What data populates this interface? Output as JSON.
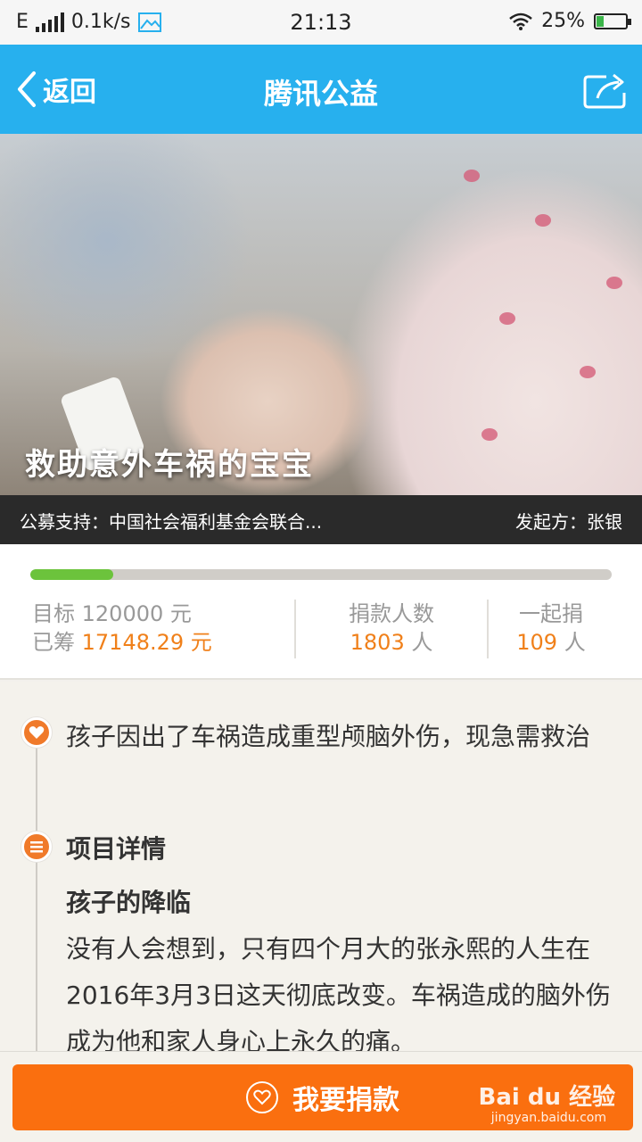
{
  "status_bar": {
    "network": "E",
    "speed": "0.1k/s",
    "time": "21:13",
    "battery": "25%",
    "battery_level": 0.25
  },
  "nav": {
    "back_label": "返回",
    "title": "腾讯公益"
  },
  "hero": {
    "title": "救助意外车祸的宝宝",
    "support": "公募支持：中国社会福利基金会联合...",
    "initiator": "发起方：张银"
  },
  "stats": {
    "progress_fraction": 0.143,
    "target_label": "目标",
    "target_value": "120000",
    "target_unit": "元",
    "raised_label": "已筹",
    "raised_value": "17148.29",
    "raised_unit": "元",
    "donors_label": "捐款人数",
    "donors_value": "1803",
    "donors_unit": "人",
    "together_label": "一起捐",
    "together_value": "109",
    "together_unit": "人"
  },
  "content": {
    "summary": "孩子因出了车祸造成重型颅脑外伤，现急需救治",
    "detail_heading": "项目详情",
    "sub_heading": "孩子的降临",
    "paragraph": "没有人会想到，只有四个月大的张永熙的人生在2016年3月3日这天彻底改变。车祸造成的脑外伤成为他和家人身心上永久的痛。"
  },
  "bottom": {
    "donate_label": "我要捐款",
    "watermark": "Bai du 经验",
    "watermark_url": "jingyan.baidu.com"
  },
  "colors": {
    "nav_bg": "#27b0ee",
    "accent_orange": "#fa6f0f",
    "progress_green": "#6cc33c"
  }
}
